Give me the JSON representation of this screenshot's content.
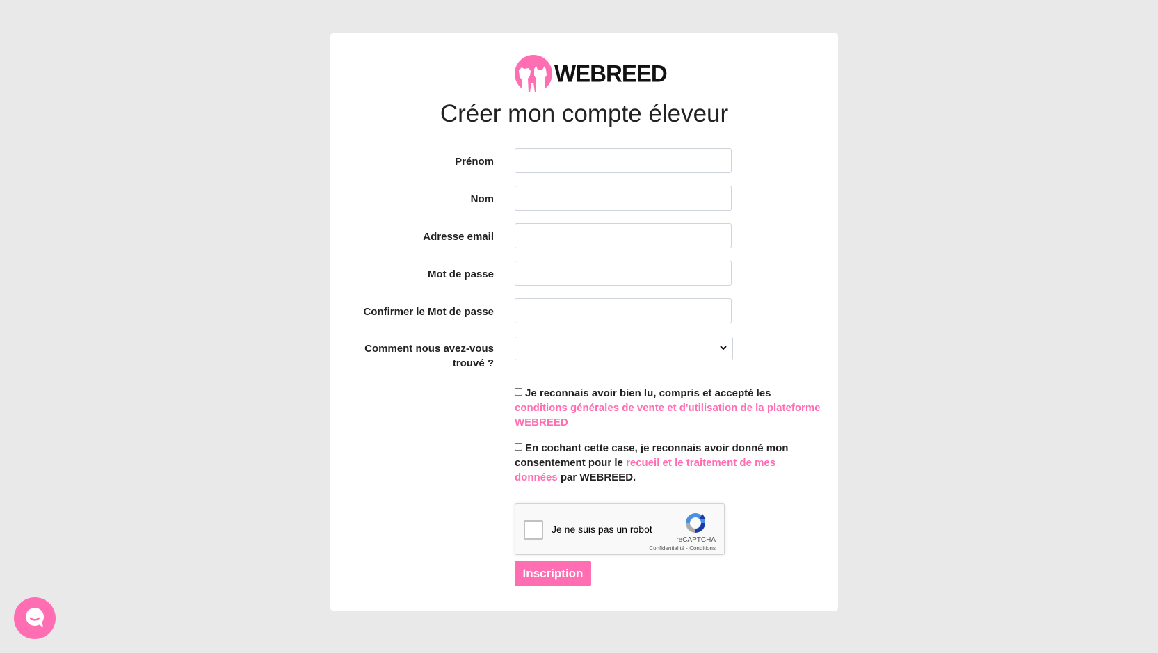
{
  "brand": {
    "name": "WEBREED",
    "accent_color": "#ff6db2",
    "logo_icon": "dog-and-cat-logo-icon"
  },
  "page": {
    "title": "Créer mon compte éleveur"
  },
  "form": {
    "fields": [
      {
        "label": "Prénom",
        "value": "",
        "placeholder": ""
      },
      {
        "label": "Nom",
        "value": "",
        "placeholder": ""
      },
      {
        "label": "Adresse email",
        "value": "",
        "placeholder": ""
      },
      {
        "label": "Mot de passe",
        "value": "",
        "placeholder": ""
      },
      {
        "label": "Confirmer le Mot de passe",
        "value": "",
        "placeholder": ""
      }
    ],
    "source_select": {
      "label_line1": "Comment nous avez-vous",
      "label_line2": "trouvé ?",
      "selected": ""
    },
    "terms": {
      "checked": false,
      "text_before": "Je reconnais avoir bien lu, compris et accepté les",
      "link": "conditions générales de vente et d'utilisation de la plateforme WEBREED"
    },
    "consent": {
      "checked": false,
      "text_before": "En cochant cette case, je reconnais avoir donné mon consentement pour le",
      "link": "recueil et le traitement de mes données",
      "text_after": "par WEBREED."
    },
    "recaptcha": {
      "label": "Je ne suis pas un robot",
      "brand": "reCAPTCHA",
      "privacy": "Confidentialité",
      "separator": "-",
      "terms": "Conditions"
    },
    "submit_label": "Inscription"
  },
  "chat_widget": {
    "icon": "chat-bubble-icon"
  }
}
